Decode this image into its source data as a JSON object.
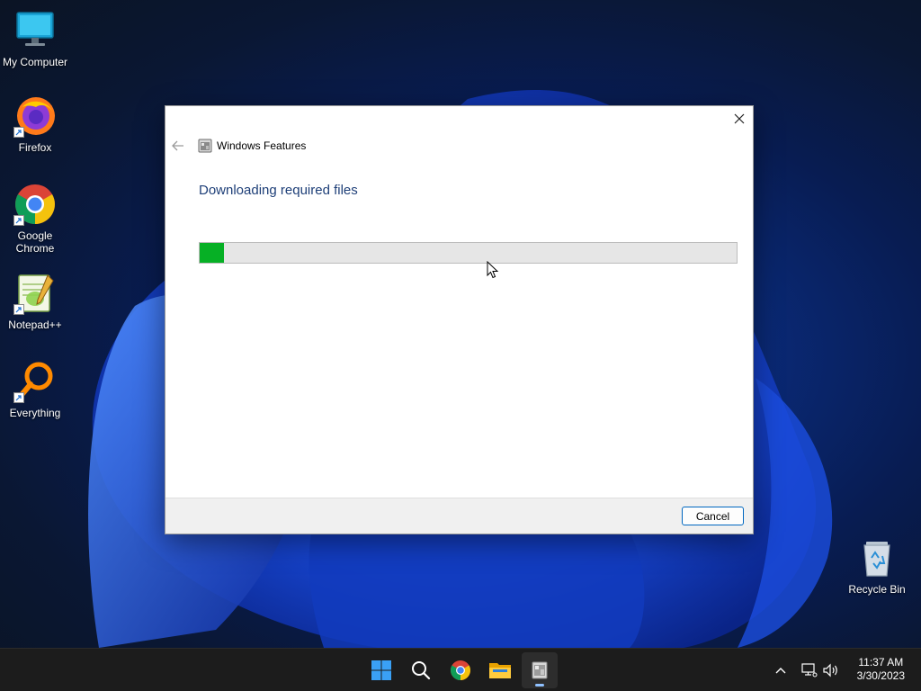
{
  "desktop": {
    "icons": [
      {
        "label": "My Computer"
      },
      {
        "label": "Firefox"
      },
      {
        "label": "Google Chrome"
      },
      {
        "label": "Notepad++"
      },
      {
        "label": "Everything"
      },
      {
        "label": "Recycle Bin"
      }
    ]
  },
  "dialog": {
    "title": "Windows Features",
    "heading": "Downloading required files",
    "progress": 0.046,
    "progress_color": "#06b025",
    "cancel_label": "Cancel"
  },
  "taskbar": {
    "pinned": [
      "start-icon",
      "search-icon",
      "chrome-icon",
      "file-explorer-icon",
      "windows-features-icon"
    ],
    "clock": {
      "time": "11:37 AM",
      "date": "3/30/2023"
    }
  },
  "colors": {
    "accent": "#0067c0",
    "heading": "#1e3f78",
    "taskbar": "#1c1c1c"
  }
}
